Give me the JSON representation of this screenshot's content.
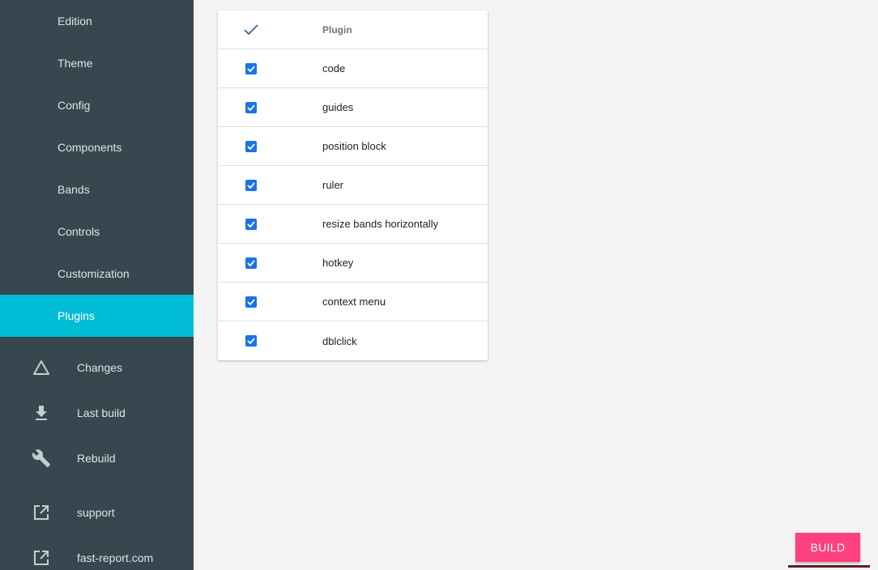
{
  "sidebar": {
    "nav": [
      {
        "label": "Edition"
      },
      {
        "label": "Theme"
      },
      {
        "label": "Config"
      },
      {
        "label": "Components"
      },
      {
        "label": "Bands"
      },
      {
        "label": "Controls"
      },
      {
        "label": "Customization"
      },
      {
        "label": "Plugins",
        "active": true
      }
    ],
    "actions": [
      {
        "label": "Changes",
        "icon": "triangle-icon"
      },
      {
        "label": "Last build",
        "icon": "download-icon"
      },
      {
        "label": "Rebuild",
        "icon": "wrench-icon"
      }
    ],
    "links": [
      {
        "label": "support",
        "icon": "open-in-new-icon"
      },
      {
        "label": "fast-report.com",
        "icon": "open-in-new-icon"
      }
    ]
  },
  "table": {
    "header": {
      "column": "Plugin"
    },
    "rows": [
      {
        "name": "code",
        "checked": true
      },
      {
        "name": "guides",
        "checked": true
      },
      {
        "name": "position block",
        "checked": true
      },
      {
        "name": "ruler",
        "checked": true
      },
      {
        "name": "resize bands horizontally",
        "checked": true
      },
      {
        "name": "hotkey",
        "checked": true
      },
      {
        "name": "context menu",
        "checked": true
      },
      {
        "name": "dblclick",
        "checked": true
      }
    ]
  },
  "build_button": {
    "label": "BUILD"
  },
  "colors": {
    "sidebar": "#37474f",
    "active": "#00bcd4",
    "checkbox": "#1a73e8",
    "build": "#ff4081"
  }
}
